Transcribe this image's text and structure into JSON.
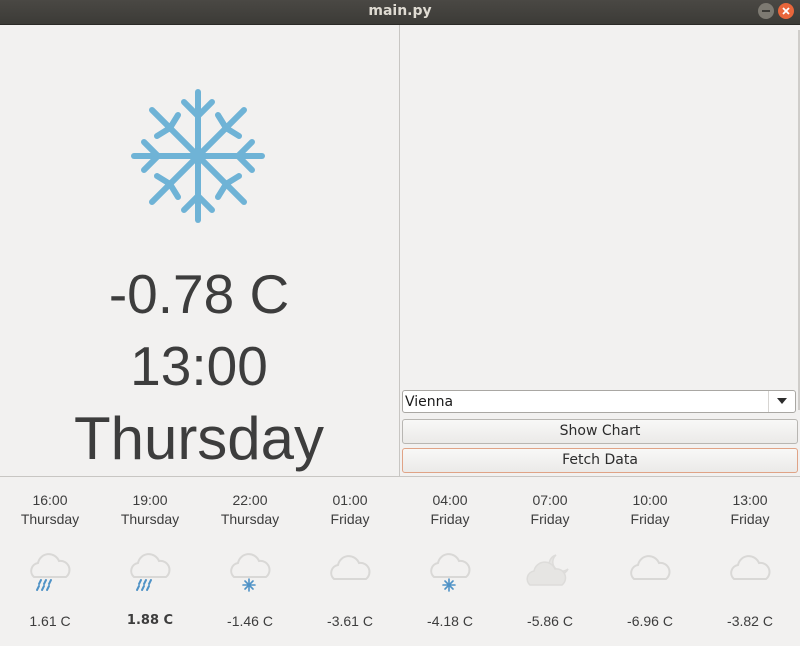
{
  "window": {
    "title": "main.py"
  },
  "current": {
    "icon": "snowflake-icon",
    "temperature": "-0.78 C",
    "time": "13:00",
    "day": "Thursday"
  },
  "controls": {
    "city_selected": "Vienna",
    "show_chart_label": "Show Chart",
    "fetch_data_label": "Fetch Data"
  },
  "forecast": [
    {
      "time": "16:00",
      "day": "Thursday",
      "temp": "1.61 C",
      "icon": "cloud-rain-icon"
    },
    {
      "time": "19:00",
      "day": "Thursday",
      "temp": "1.88 C",
      "icon": "cloud-rain-icon"
    },
    {
      "time": "22:00",
      "day": "Thursday",
      "temp": "-1.46 C",
      "icon": "cloud-snow-icon"
    },
    {
      "time": "01:00",
      "day": "Friday",
      "temp": "-3.61 C",
      "icon": "cloud-icon"
    },
    {
      "time": "04:00",
      "day": "Friday",
      "temp": "-4.18 C",
      "icon": "cloud-snow-icon"
    },
    {
      "time": "07:00",
      "day": "Friday",
      "temp": "-5.86 C",
      "icon": "cloud-moon-icon"
    },
    {
      "time": "10:00",
      "day": "Friday",
      "temp": "-6.96 C",
      "icon": "cloud-icon"
    },
    {
      "time": "13:00",
      "day": "Friday",
      "temp": "-3.82 C",
      "icon": "cloud-icon"
    }
  ],
  "colors": {
    "snow_blue": "#6fb3d6",
    "cloud_gray": "#d9d8d6",
    "text": "#3d3d3d"
  }
}
